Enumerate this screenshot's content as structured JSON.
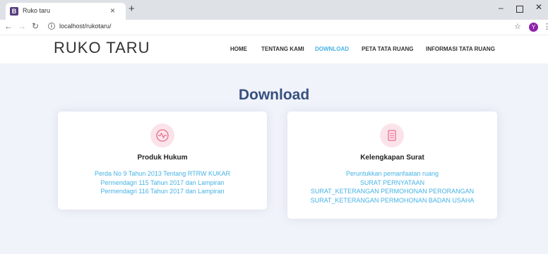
{
  "browser": {
    "tab_title": "Ruko taru",
    "favicon_letter": "B",
    "url": "localhost/rukotaru/",
    "profile_initial": "Y"
  },
  "site": {
    "brand": "RUKO TARU",
    "nav": [
      "HOME",
      "TENTANG KAMI",
      "DOWNLOAD",
      "PETA TATA RUANG",
      "INFORMASI TATA RUANG"
    ],
    "active_nav": "DOWNLOAD"
  },
  "section": {
    "title": "Download"
  },
  "cards": [
    {
      "title": "Produk Hukum",
      "icon": "activity-icon",
      "links": [
        "Perda No 9 Tahun 2013 Tentang RTRW KUKAR",
        "Permendagri 115 Tahun 2017 dan Lampiran",
        "Permendagri 116 Tahun 2017 dan Lampiran"
      ]
    },
    {
      "title": "Kelengkapan Surat",
      "icon": "file-icon",
      "links": [
        "Peruntukkan pemanfaatan ruang",
        "SURAT PERNYATAAN",
        "SURAT_KETERANGAN PERMOHONAN PERORANGAN",
        "SURAT_KETERANGAN PERMOHONAN BADAN USAHA"
      ]
    }
  ],
  "colors": {
    "accent": "#47b2e4",
    "heading": "#37517e",
    "icon_bg": "#fbe3ea",
    "icon_stroke": "#e96b8c",
    "page_bg": "#f1f3fa"
  }
}
